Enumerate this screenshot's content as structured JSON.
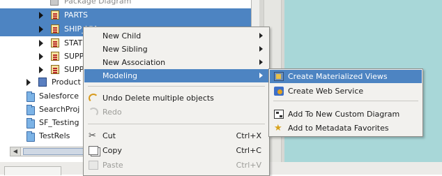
{
  "tree": {
    "rows": [
      {
        "label": "Package Diagram"
      },
      {
        "label": "PARTS"
      },
      {
        "label": "SHIP_VIA"
      },
      {
        "label": "STAT"
      },
      {
        "label": "SUPP"
      },
      {
        "label": "SUPP"
      },
      {
        "label": "Product"
      },
      {
        "label": "Salesforce"
      },
      {
        "label": "SearchProj"
      },
      {
        "label": "SF_Testing"
      },
      {
        "label": "TestRels"
      }
    ]
  },
  "context_menu": {
    "new_child": "New Child",
    "new_sibling": "New Sibling",
    "new_association": "New Association",
    "modeling": "Modeling",
    "undo": "Undo Delete multiple objects",
    "redo": "Redo",
    "cut": "Cut",
    "cut_shortcut": "Ctrl+X",
    "copy": "Copy",
    "copy_shortcut": "Ctrl+C",
    "paste": "Paste",
    "paste_shortcut": "Ctrl+V"
  },
  "modeling_submenu": {
    "create_materialized_views": "Create Materialized Views",
    "create_web_service": "Create Web Service",
    "add_to_custom_diagram": "Add To New Custom Diagram",
    "add_to_favorites": "Add to Metadata Favorites"
  },
  "colors": {
    "selection": "#4d84c2",
    "menu_bg": "#f2f1ee",
    "right_pane": "#a8d7d8"
  }
}
